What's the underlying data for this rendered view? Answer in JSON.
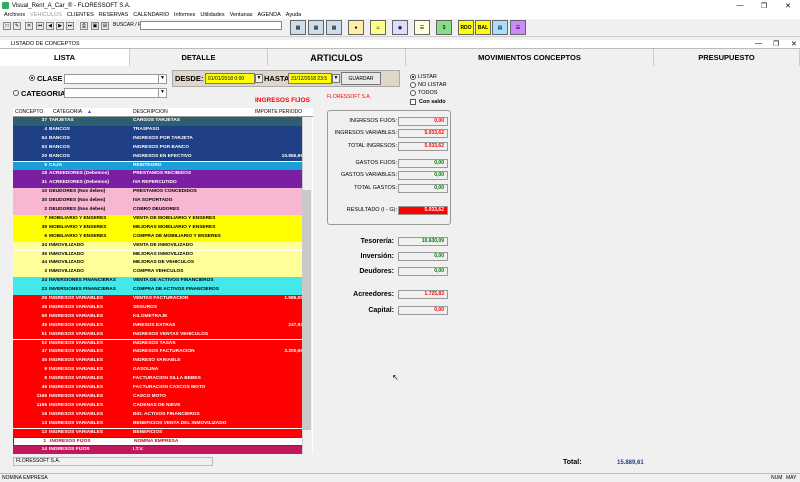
{
  "window": {
    "title": "Visual_Rent_A_Car_® - FLORESSOFT S.A."
  },
  "menu": [
    "Archivos",
    "VEHICULOS",
    "CLIENTES",
    "RESERVAS",
    "CALENDARIO",
    "Informes",
    "Utilidades",
    "Ventanas",
    "AGENDA",
    "Ayuda"
  ],
  "toolbar": {
    "search_label": "BUSCAR / FILTRAR:",
    "search_value": "",
    "big_buttons": [
      "RDO",
      "BAL"
    ]
  },
  "child_window": {
    "title": "LISTADO DE CONCEPTOS"
  },
  "tabs": [
    "LISTA",
    "DETALLE",
    "ARTICULOS",
    "MOVIMIENTOS CONCEPTOS",
    "PRESUPUESTO"
  ],
  "filters": {
    "clase_label": "CLASE",
    "categoria_label": "CATEGORIA",
    "desde_label": "DESDE:",
    "desde_value": "01/01/2018 0:00",
    "hasta_label": "HASTA:",
    "hasta_value": "31/12/2018 23:5",
    "guardar": "GUARDAR",
    "opts": [
      "LISTAR",
      "NO LISTAR",
      "TODOS"
    ],
    "con_saldo": "Con saldo"
  },
  "grid": {
    "title": "INGRESOS FIJOS",
    "columns": [
      "CONCEPTO",
      "CATEGORIA",
      "DESCRIPCION",
      "IMPORTE PERIODO"
    ],
    "rows": [
      [
        "37",
        "TARJETAS",
        "CARGOS TARJETAS",
        "",
        "#2e5f6e"
      ],
      [
        "4",
        "BANCOS",
        "TRASPASO",
        "",
        "#1f3f86"
      ],
      [
        "54",
        "BANCOS",
        "INGRESOS POR TARJETA",
        "",
        "#1f3f86"
      ],
      [
        "53",
        "BANCOS",
        "INGRESOS POR BANCO",
        "",
        "#1f3f86"
      ],
      [
        "20",
        "BANCOS",
        "INGRESOS EN EFECTIVO",
        "10.855,99",
        "#1f3f86"
      ],
      [
        "5",
        "CAJA",
        "REINTEGRO",
        "",
        "#1aa0d8"
      ],
      [
        "18",
        "ACREEDORES (Debemos)",
        "PRESTAMOS RECIBIDOS",
        "",
        "#7b1fa2"
      ],
      [
        "31",
        "ACREEDORES (Debemos)",
        "IVA REPERCUTIDO",
        "",
        "#7b1fa2"
      ],
      [
        "10",
        "DEUDORES (Nos deben)",
        "PRESTAMOS CONCEDIDOS",
        "",
        "#f7b7d2"
      ],
      [
        "30",
        "DEUDORES (Nos deben)",
        "IVA SOPORTADO",
        "",
        "#f7b7d2"
      ],
      [
        "2",
        "DEUDORES (Nos deben)",
        "COBRO DEUDORES",
        "",
        "#f7b7d2"
      ],
      [
        "7",
        "MOBILIARIO Y ENSERES",
        "VENTA DE MOBILIARIO Y ENSERES",
        "",
        "#ffff00"
      ],
      [
        "39",
        "MOBILIARIO Y ENSERES",
        "MEJORAS MOBILIARIO Y ENSERES",
        "",
        "#ffff00"
      ],
      [
        "6",
        "MOBILIARIO Y ENSERES",
        "COMPRA DE MOBILIARIO Y ENSERES",
        "",
        "#ffff00"
      ],
      [
        "34",
        "INMOVILIZADO",
        "VENTA DE INMOVILIZADO",
        "",
        "#ffff99"
      ],
      [
        "36",
        "INMOVILIZADO",
        "MEJORAS INMOVILIZADO",
        "",
        "#ffff99"
      ],
      [
        "44",
        "INMOVILIZADO",
        "MEJORAS DE VEHICULOS",
        "",
        "#ffff99"
      ],
      [
        "3",
        "INMOVILIZADO",
        "COMPRA VEHICULOS",
        "",
        "#ffff99"
      ],
      [
        "24",
        "INVERSIONES FINANCIERAS",
        "VENTA DE ACTIVOS FINANCIEROS",
        "",
        "#44e8e8"
      ],
      [
        "23",
        "INVERSIONES FINANCIERAS",
        "COMPRA DE ACTIVOS FINANCIEROS",
        "",
        "#44e8e8"
      ],
      [
        "26",
        "INGRESOS VARIABLES",
        "VENTAS FACTURACION",
        "1.585,00",
        "#f00"
      ],
      [
        "48",
        "INGRESOS VARIABLES",
        "SEGUROS",
        "",
        "#f00"
      ],
      [
        "50",
        "INGRESOS VARIABLES",
        "KILOMETRAJE",
        "",
        "#f00"
      ],
      [
        "49",
        "INGRESOS VARIABLES",
        "INRESOS EXTRAS",
        "247,93",
        "#f00"
      ],
      [
        "51",
        "INGRESOS VARIABLES",
        "INGRESOS VENTAS VEHICULOS",
        "",
        "#f00"
      ],
      [
        "52",
        "INGRESOS VARIABLES",
        "INGRESOS TASAS",
        "",
        "#f00"
      ],
      [
        "47",
        "INGRESOS VARIABLES",
        "INGRESOS FACTURACION",
        "3.200,68",
        "#f00"
      ],
      [
        "45",
        "INGRESOS VARIABLES",
        "INGRESO VARIABLE",
        "",
        "#f00"
      ],
      [
        "9",
        "INGRESOS VARIABLES",
        "GASOLINA",
        "",
        "#f00"
      ],
      [
        "8",
        "INGRESOS VARIABLES",
        "FACTURACION SILLA BEBES",
        "",
        "#f00"
      ],
      [
        "46",
        "INGRESOS VARIABLES",
        "FACTURACION CASCOS MOTO",
        "",
        "#f00"
      ],
      [
        "1166",
        "INGRESOS VARIABLES",
        "CASCO MOTO",
        "",
        "#f00"
      ],
      [
        "1165",
        "INGRESOS VARIABLES",
        "CADENAS DE NIEVE",
        "",
        "#f00"
      ],
      [
        "16",
        "INGRESOS VARIABLES",
        "BIO. ACTIVOS FINANCIEROS",
        "",
        "#f00"
      ],
      [
        "13",
        "INGRESOS VARIABLES",
        "BENEFICIOS VENTA DEL INMOVILIZADO",
        "",
        "#f00"
      ],
      [
        "12",
        "INGRESOS VARIABLES",
        "BENEFICIOS",
        "",
        "#f00"
      ],
      [
        "1",
        "INGRESOS FIJOS",
        "NOMINA EMPRESA",
        "",
        "#fff"
      ],
      [
        "14",
        "INGRESOS FIJOS",
        "I.T.V.",
        "",
        "#c2185b"
      ]
    ]
  },
  "company_red": "FLORESSOFT S.A.",
  "grid_footer": "FLORESSOFT S.A.",
  "summary": {
    "ingresos_fijos_label": "INGRESOS FIJOS:",
    "ingresos_fijos": "0,00",
    "ingresos_variables_label": "INGRESOS VARIABLES:",
    "ingresos_variables": "5.033,62",
    "total_ingresos_label": "TOTAL INGRESOS:",
    "total_ingresos": "5.033,62",
    "gastos_fijos_label": "GASTOS FIJOS:",
    "gastos_fijos": "0,00",
    "gastos_variables_label": "GASTOS VARIABLES:",
    "gastos_variables": "0,00",
    "total_gastos_label": "TOTAL GASTOS:",
    "total_gastos": "0,00",
    "resultado_label": "RESULTADO (I - G):",
    "resultado": "5.033,62",
    "tesoreria_label": "Tesorería:",
    "tesoreria": "10.630,09",
    "inversion_label": "Inversión:",
    "inversion": "0,00",
    "deudores_label": "Deudores:",
    "deudores": "0,00",
    "acreedores_label": "Acreedores:",
    "acreedores": "1.725,83",
    "capital_label": "Capital:",
    "capital": "0,00",
    "total_label": "Total:",
    "total": "15.889,61"
  },
  "statusbar": {
    "left": "NOMINA EMPRESA",
    "num": "NUM",
    "may": "MAY"
  }
}
